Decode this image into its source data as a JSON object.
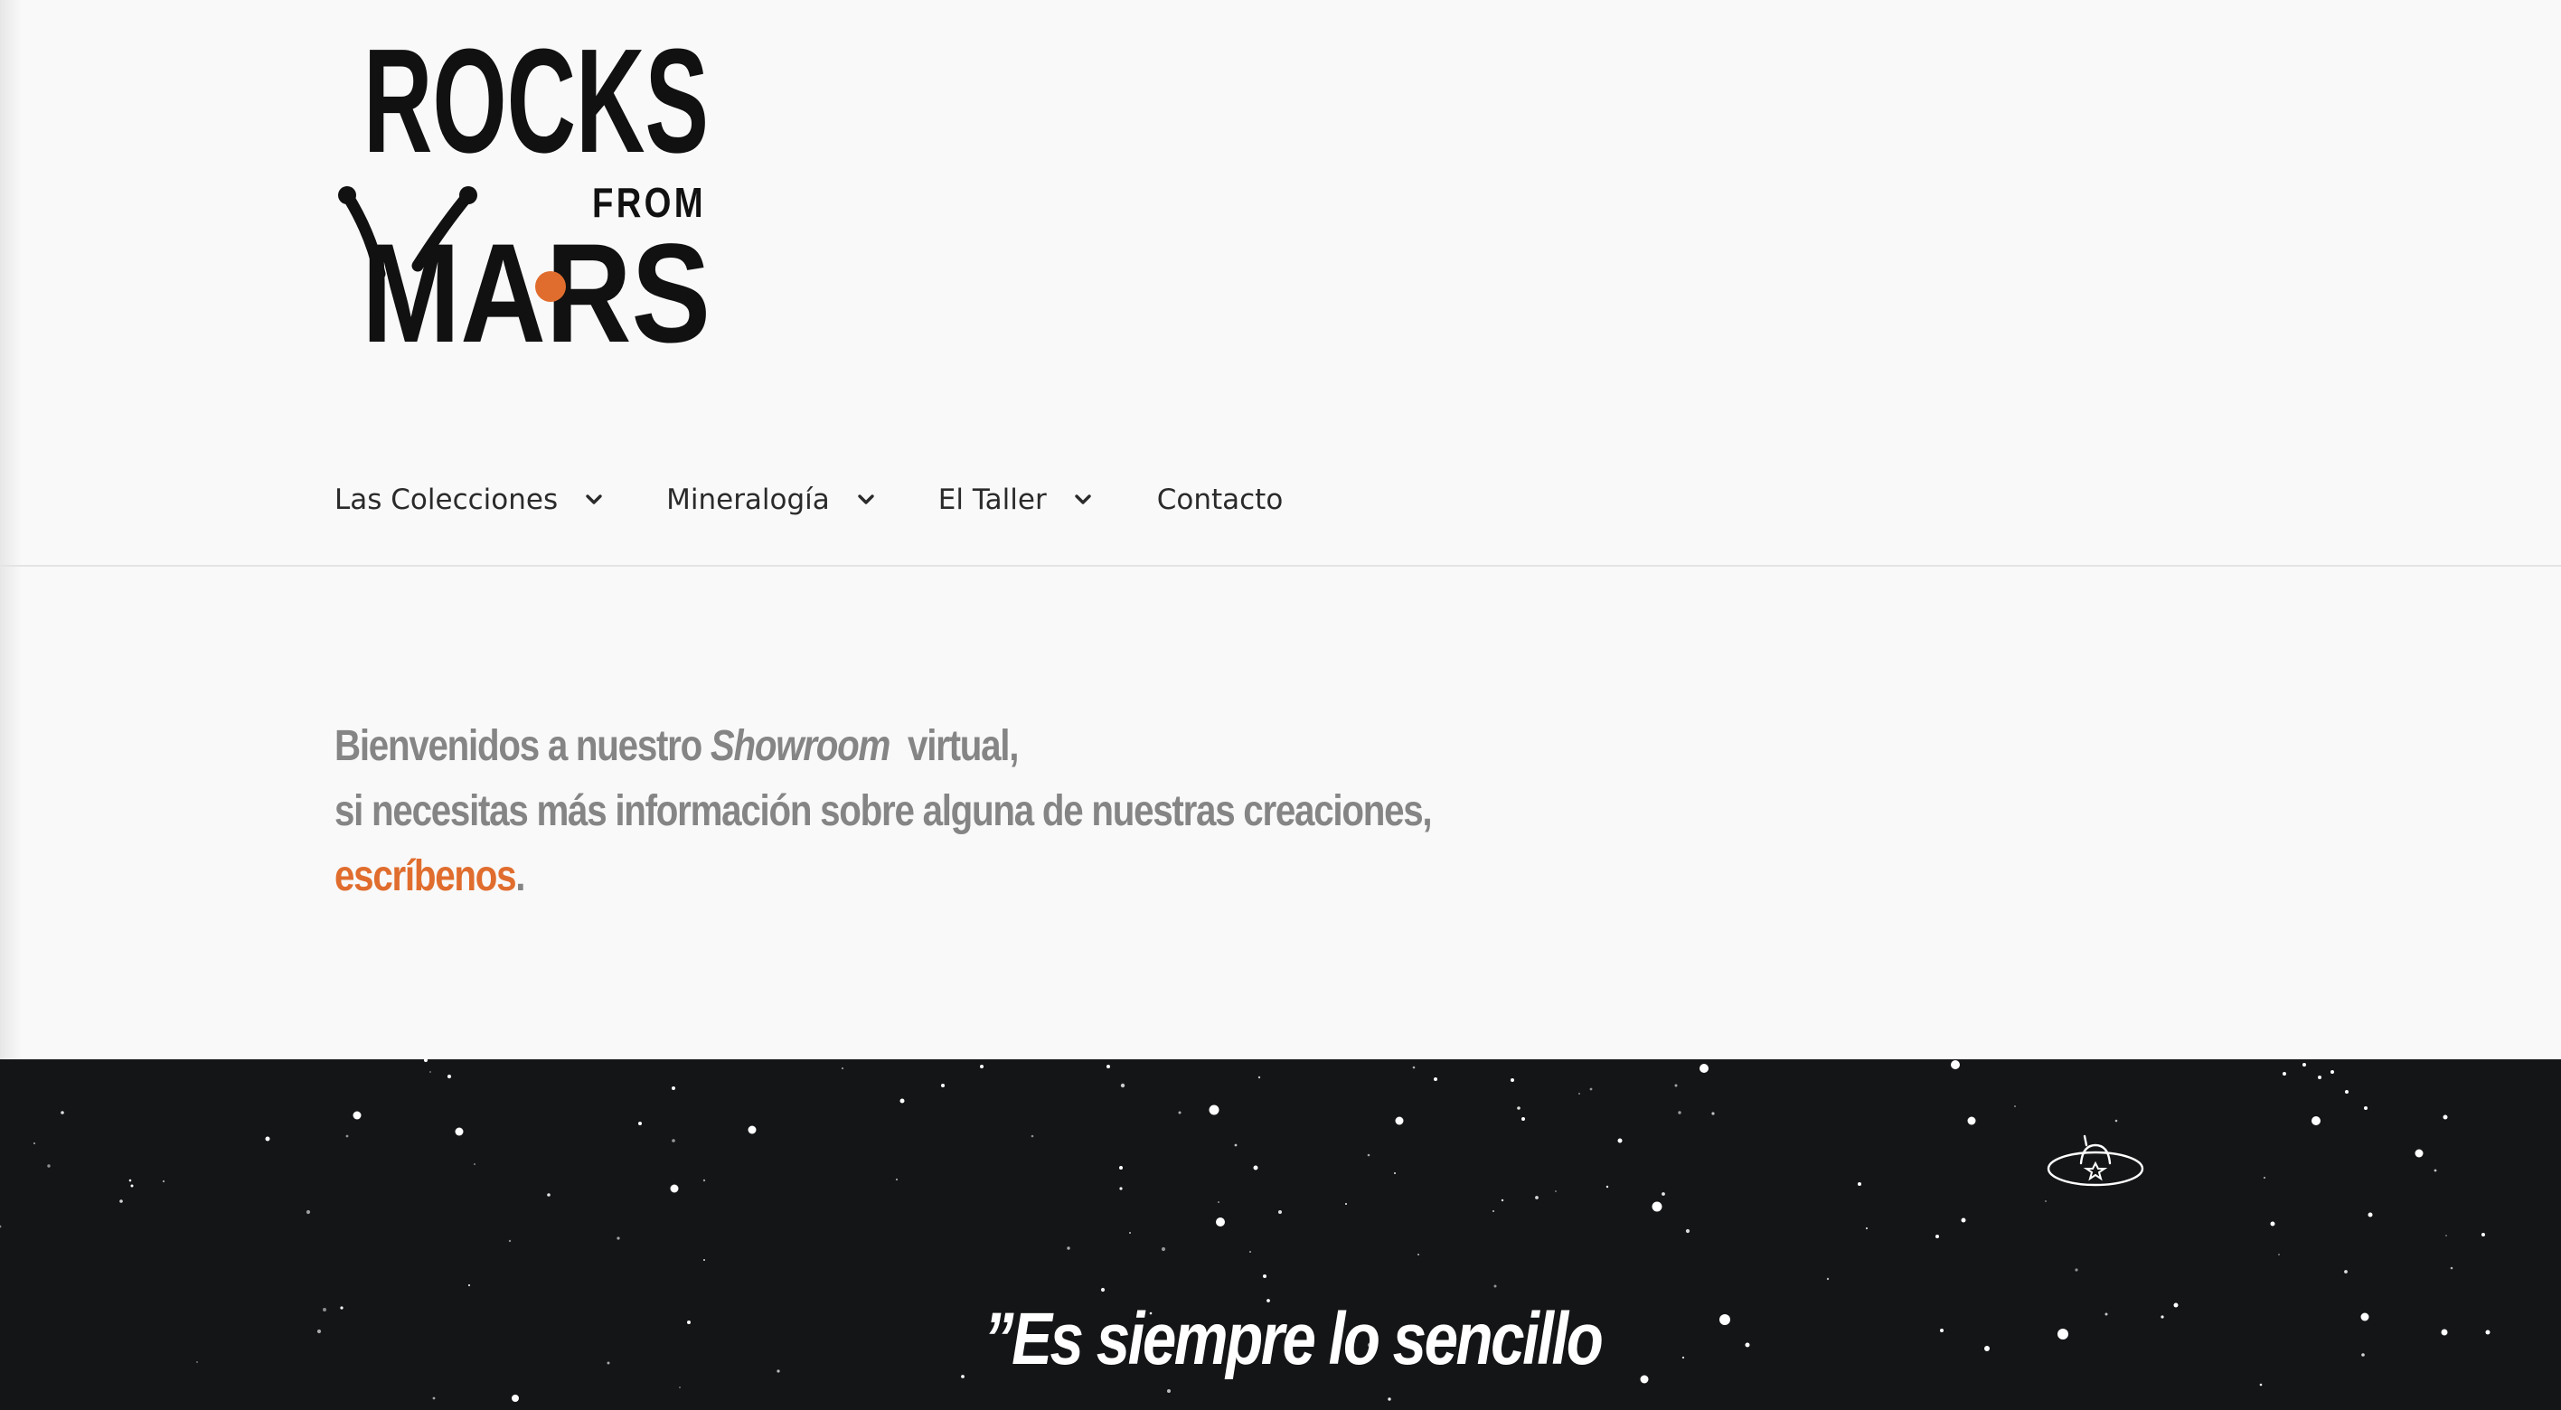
{
  "brand": {
    "logo_word_top": "ROCKS",
    "logo_word_small": "FROM",
    "logo_word_bottom": "MARS",
    "accent_color": "#e06d2e"
  },
  "nav": {
    "items": [
      {
        "label": "Las Colecciones",
        "has_dropdown": true
      },
      {
        "label": "Mineralogía",
        "has_dropdown": true
      },
      {
        "label": "El Taller",
        "has_dropdown": true
      },
      {
        "label": "Contacto",
        "has_dropdown": false
      }
    ]
  },
  "welcome": {
    "line1_prefix": "Bienvenidos a nuestro ",
    "line1_emphasis": "Showroom",
    "line1_suffix": "  virtual,",
    "line2": "si necesitas más información sobre alguna de nuestras creaciones,",
    "link_text": "escríbenos",
    "line3_suffix": "."
  },
  "banner": {
    "quote": "”Es siempre lo sencillo",
    "icon": "ufo-icon",
    "background_color": "#141517"
  }
}
